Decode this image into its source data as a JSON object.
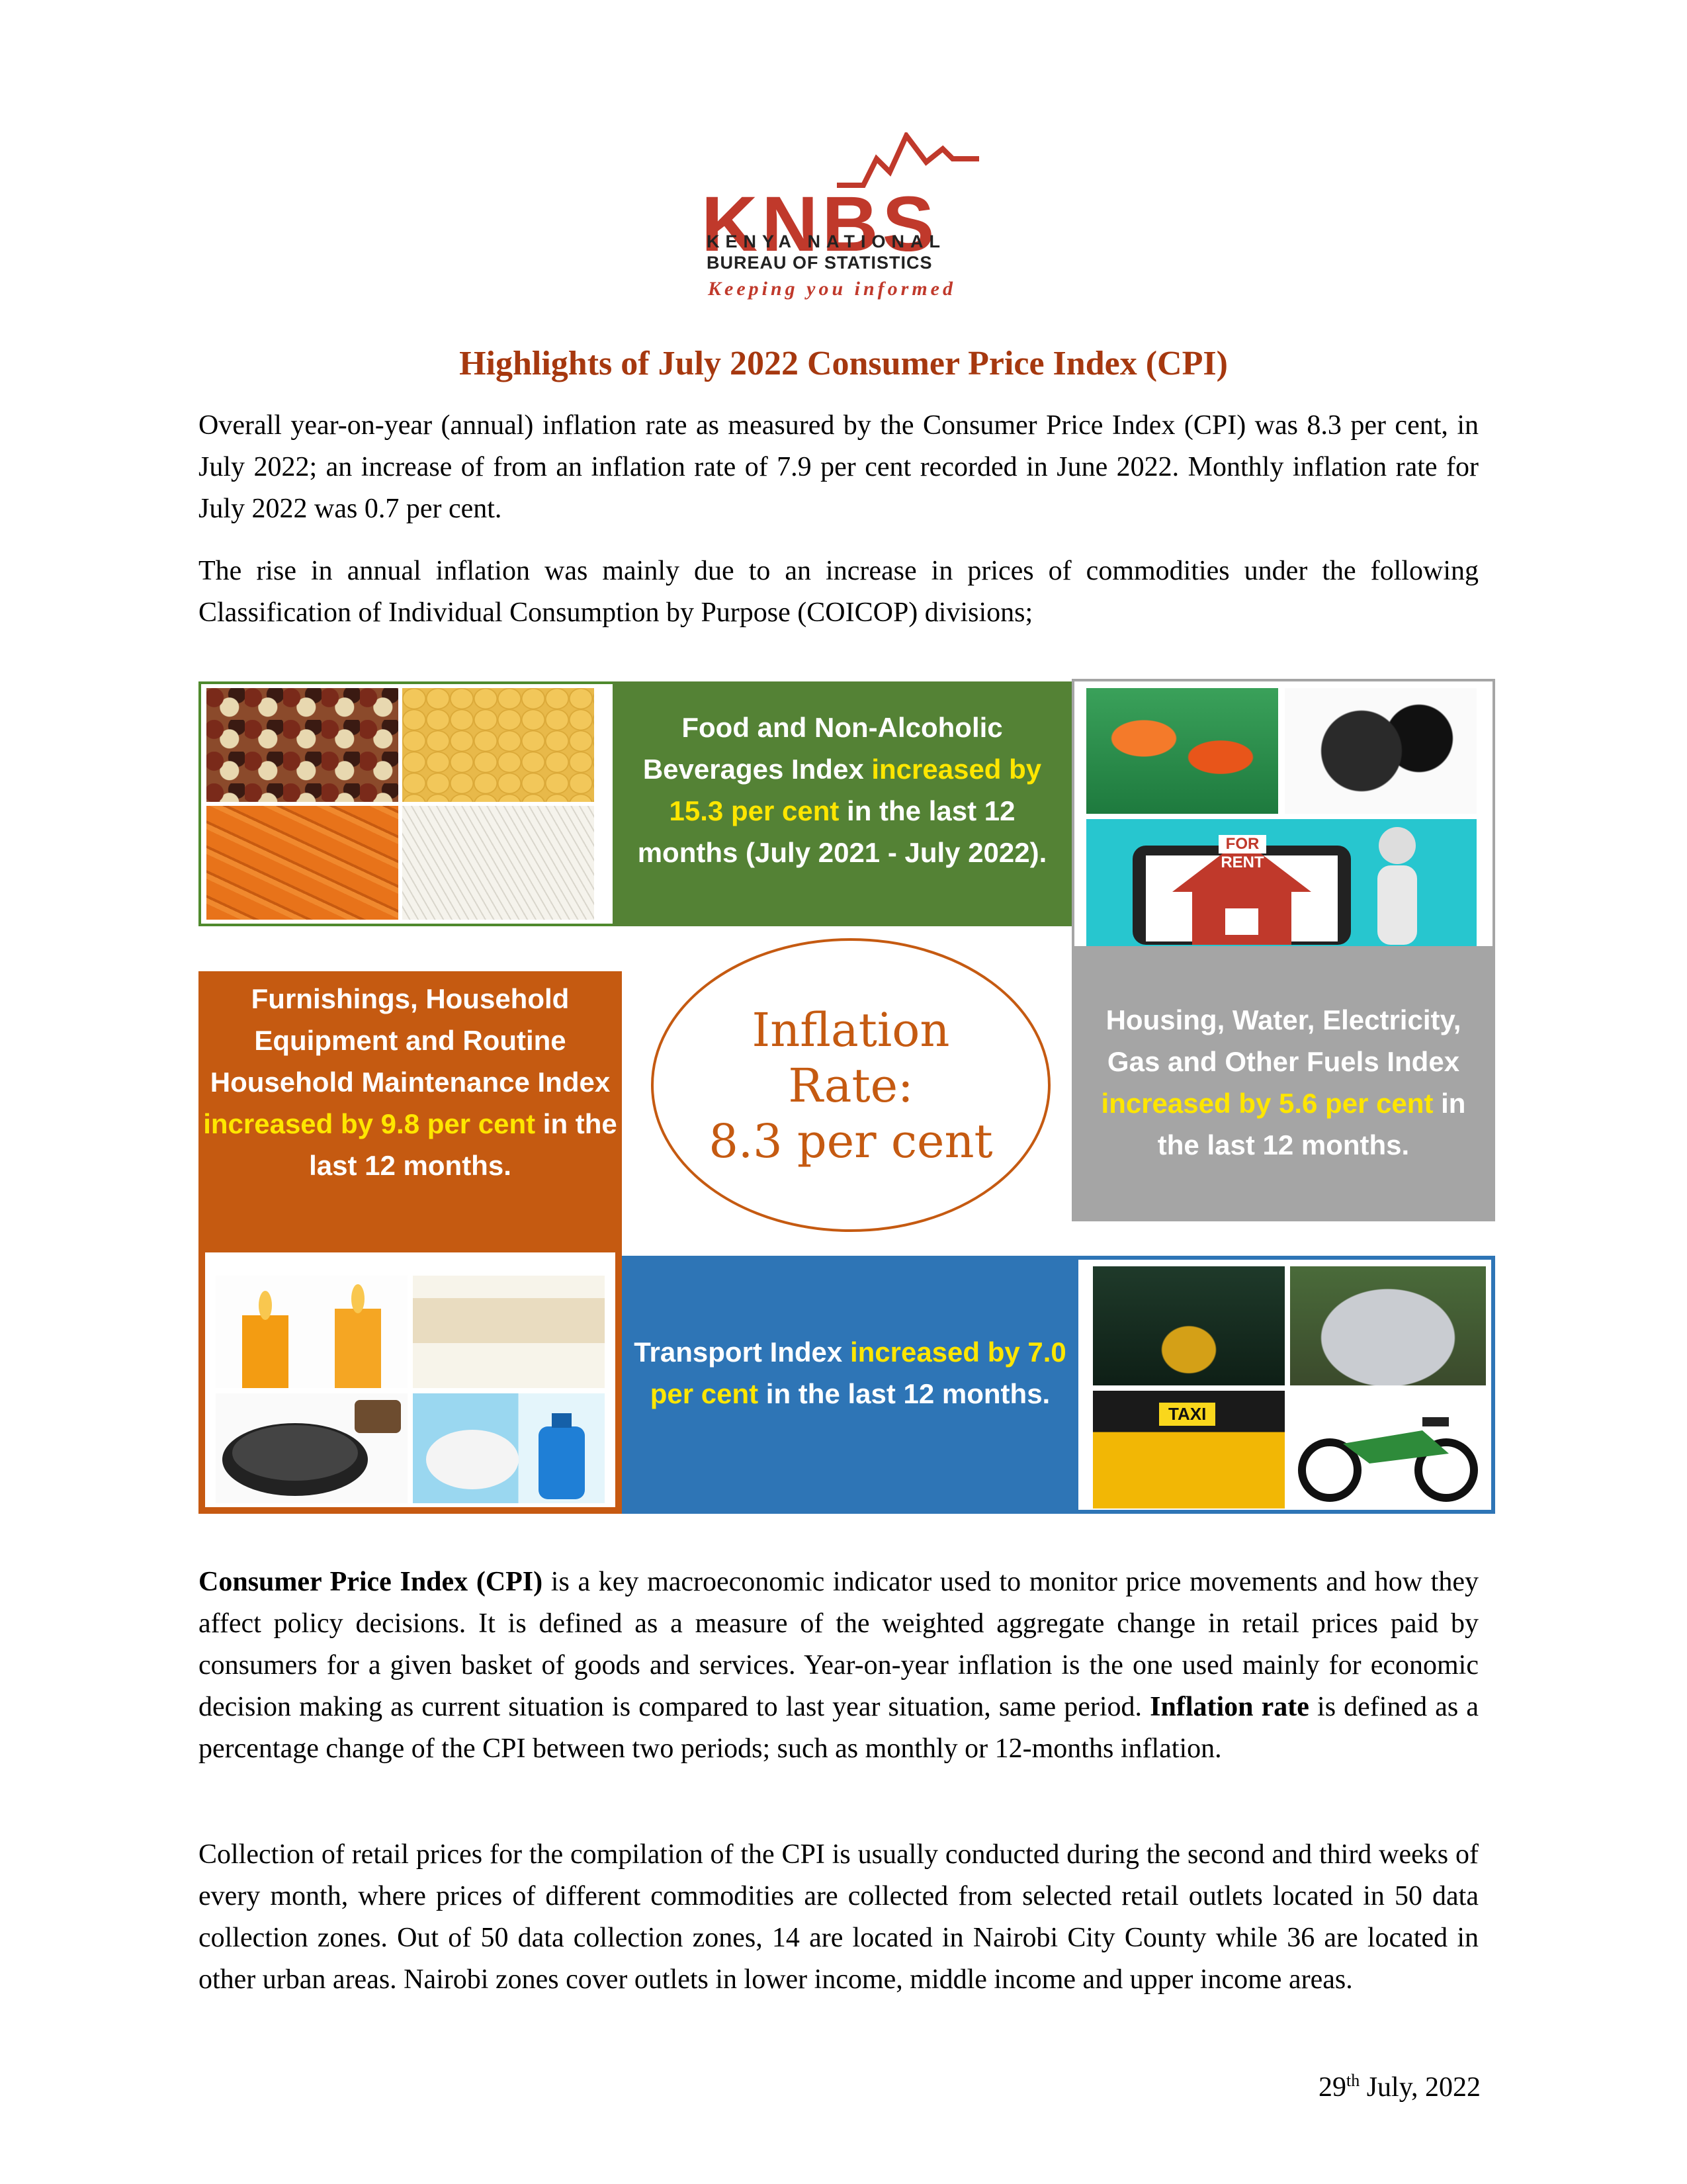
{
  "logo": {
    "wordmark": "KNBS",
    "line1": "KENYA NATIONAL",
    "line2": "BUREAU OF STATISTICS",
    "tagline": "Keeping you informed",
    "colors": {
      "brand_red": "#c0392b",
      "dark": "#222222"
    }
  },
  "title": "Highlights of July 2022 Consumer Price Index (CPI)",
  "intro": {
    "p1": "Overall year-on-year (annual) inflation rate as measured by the Consumer Price Index (CPI) was 8.3 per cent, in July 2022; an increase of from an inflation rate of 7.9 per cent recorded in June 2022. Monthly inflation rate for July 2022 was 0.7 per cent.",
    "p2": "The rise in annual inflation was mainly due to an increase in prices of commodities under the following Classification of Individual Consumption by Purpose (COICOP) divisions;"
  },
  "infographic": {
    "center": {
      "line1": "Inflation",
      "line2": "Rate:",
      "line3": "8.3 per cent"
    },
    "food": {
      "pre": "Food and Non-Alcoholic Beverages Index ",
      "highlight": "increased by 15.3 per cent",
      "post": " in the last 12 months (July 2021 - July 2022)."
    },
    "housing": {
      "pre": "Housing, Water, Electricity, Gas and Other Fuels Index ",
      "highlight": "increased by 5.6 per cent",
      "post": " in the last 12 months."
    },
    "furnishings": {
      "pre": "Furnishings, Household Equipment and Routine Household Maintenance Index ",
      "highlight": "increased by 9.8 per cent",
      "post": " in the last 12 months."
    },
    "transport": {
      "pre": "Transport Index ",
      "highlight": "increased by 7.0 per cent",
      "post": " in the last 12 months."
    },
    "rent_sign": {
      "line1": "FOR",
      "line2": "RENT"
    },
    "taxi_sign": "TAXI",
    "colors": {
      "green": "#548235",
      "gray": "#a5a5a5",
      "orange": "#c55a11",
      "blue": "#2e75b6",
      "highlight": "#ffe600"
    }
  },
  "definitions": {
    "cpi_term": "Consumer Price Index (CPI)",
    "cpi_text": " is a key macroeconomic indicator used to monitor price movements and how they affect policy decisions. It is defined as a measure of the weighted aggregate change in retail prices paid by consumers for a given basket of goods and services. Year-on-year inflation is the one used mainly for economic decision making as current situation is compared to last year situation, same period. ",
    "inflation_term": "Inflation rate",
    "inflation_text": " is defined as a percentage change of the CPI between two periods; such as monthly or 12-months inflation.",
    "collection": "Collection of retail prices for the compilation of the CPI is usually conducted during the second and third weeks of every month, where prices of different commodities are collected from selected retail outlets located in 50 data collection zones. Out of 50 data collection zones, 14 are located in Nairobi City County while 36 are located in other urban areas. Nairobi zones cover outlets in lower income, middle income and upper income areas."
  },
  "date": {
    "day": "29",
    "suffix": "th",
    "rest": " July, 2022"
  }
}
